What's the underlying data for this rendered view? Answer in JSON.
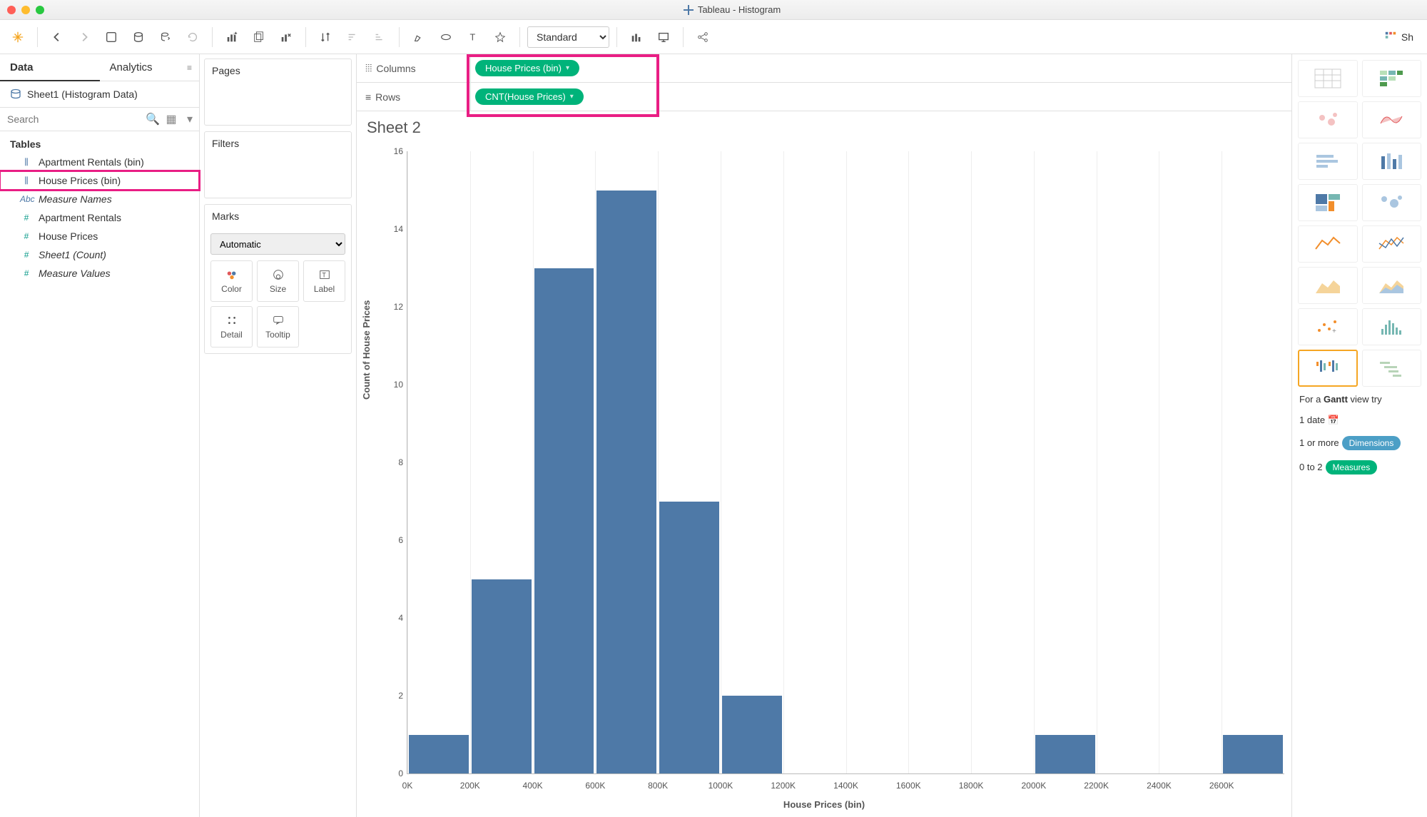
{
  "window": {
    "title": "Tableau - Histogram"
  },
  "toolbar": {
    "fit": "Standard",
    "showme": "Sh"
  },
  "side": {
    "tabs": [
      "Data",
      "Analytics"
    ],
    "datasource": "Sheet1 (Histogram Data)",
    "search_placeholder": "Search",
    "tables_label": "Tables",
    "fields": [
      {
        "icon": "bars",
        "label": "Apartment Rentals (bin)",
        "cls": "dim"
      },
      {
        "icon": "bars",
        "label": "House Prices (bin)",
        "cls": "dim highlight"
      },
      {
        "icon": "Abc",
        "label": "Measure Names",
        "cls": "dim italic"
      },
      {
        "icon": "#",
        "label": "Apartment Rentals",
        "cls": "meas"
      },
      {
        "icon": "#",
        "label": "House Prices",
        "cls": "meas"
      },
      {
        "icon": "#",
        "label": "Sheet1 (Count)",
        "cls": "meas italic"
      },
      {
        "icon": "#",
        "label": "Measure Values",
        "cls": "meas italic"
      }
    ]
  },
  "shelves": {
    "pages": "Pages",
    "filters": "Filters",
    "marks": "Marks",
    "automatic": "Automatic",
    "cells": [
      "Color",
      "Size",
      "Label",
      "Detail",
      "Tooltip"
    ]
  },
  "rc": {
    "columns_label": "Columns",
    "rows_label": "Rows",
    "columns_pill": "House Prices (bin)",
    "rows_pill": "CNT(House Prices)"
  },
  "sheet": {
    "title": "Sheet 2",
    "ylabel": "Count of House Prices",
    "xlabel": "House Prices (bin)"
  },
  "chart_data": {
    "type": "bar",
    "categories": [
      "0K",
      "200K",
      "400K",
      "600K",
      "800K",
      "1000K",
      "1200K",
      "1400K",
      "1600K",
      "1800K",
      "2000K",
      "2200K",
      "2400K",
      "2600K"
    ],
    "values": [
      1,
      5,
      13,
      15,
      7,
      2,
      0,
      0,
      0,
      0,
      1,
      0,
      0,
      1
    ],
    "title": "Sheet 2",
    "xlabel": "House Prices (bin)",
    "ylabel": "Count of House Prices",
    "ylim": [
      0,
      16
    ],
    "yticks": [
      0,
      2,
      4,
      6,
      8,
      10,
      12,
      14,
      16
    ]
  },
  "showme": {
    "hint_prefix": "For a ",
    "hint_bold": "Gantt",
    "hint_suffix": " view try",
    "line1": "1 date",
    "line2": "1 or more",
    "line2_pill": "Dimensions",
    "line3": "0 to 2",
    "line3_pill": "Measures"
  }
}
